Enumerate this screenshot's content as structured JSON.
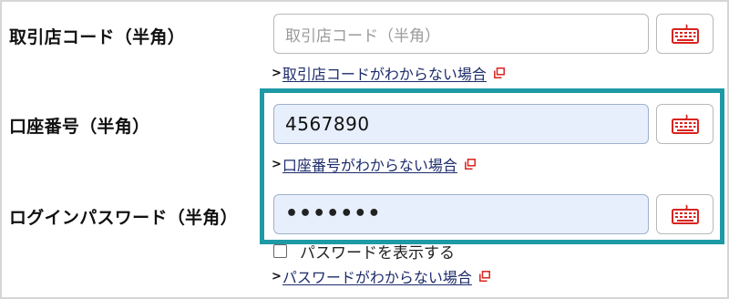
{
  "branch_code": {
    "label": "取引店コード（半角）",
    "placeholder": "取引店コード（半角）",
    "help_arrow": ">",
    "help_link": "取引店コードがわからない場合"
  },
  "account_number": {
    "label": "口座番号（半角）",
    "value": "4567890",
    "help_arrow": ">",
    "help_link": "口座番号がわからない場合"
  },
  "login_password": {
    "label": "ログインパスワード（半角）",
    "masked_value": "•••••••",
    "show_password_label": "パスワードを表示する",
    "help_arrow": ">",
    "help_link": "パスワードがわからない場合"
  },
  "icons": {
    "keyboard": "software-keyboard-icon",
    "external": "external-window-icon"
  },
  "colors": {
    "highlight": "#1e9aa6",
    "keyboard_icon": "#d9231f",
    "link": "#1d2c6b",
    "filled_bg": "#e8effc"
  }
}
